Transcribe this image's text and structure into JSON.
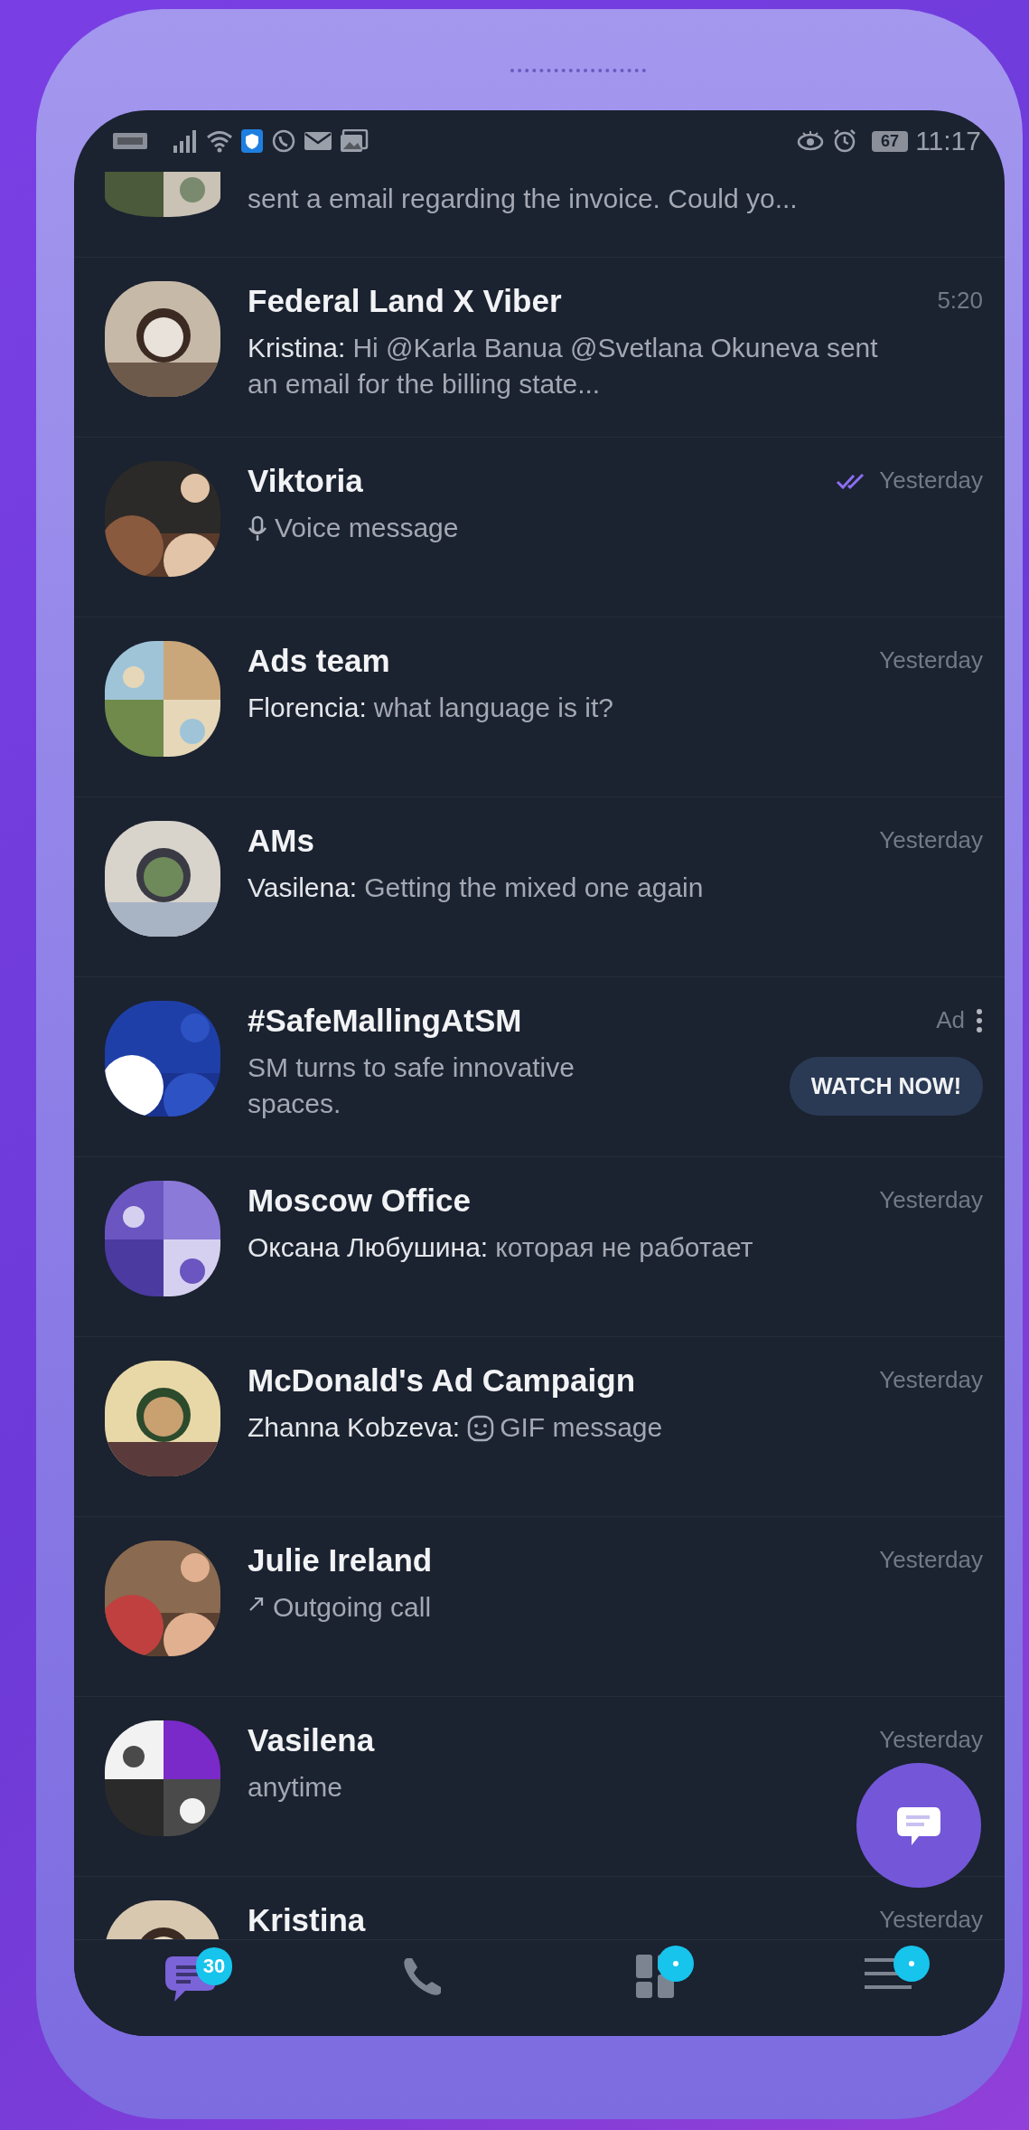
{
  "status_bar": {
    "battery": "67",
    "time": "11:17"
  },
  "partial_row": {
    "preview": "sent a email regarding the invoice. Could yo..."
  },
  "chats": [
    {
      "kind": "chat",
      "title": "Federal Land X Viber",
      "time": "5:20",
      "sender": "Kristina:",
      "preview": {
        "kind": "text",
        "text": "Hi @Karla Banua @Svetlana Okuneva sent an email for the billing state..."
      }
    },
    {
      "kind": "chat",
      "title": "Viktoria",
      "time": "Yesterday",
      "read": true,
      "preview": {
        "kind": "voice",
        "text": "Voice message"
      }
    },
    {
      "kind": "chat",
      "title": "Ads team",
      "time": "Yesterday",
      "sender": "Florencia:",
      "preview": {
        "kind": "text",
        "text": "what language is it?"
      }
    },
    {
      "kind": "chat",
      "title": "AMs",
      "time": "Yesterday",
      "sender": "Vasilena:",
      "preview": {
        "kind": "text",
        "text": "Getting the mixed one again"
      }
    },
    {
      "kind": "ad",
      "title": "#SafeMallingAtSM",
      "label": "Ad",
      "preview": "SM turns to safe innovative spaces.",
      "button": "WATCH NOW!"
    },
    {
      "kind": "chat",
      "title": "Moscow Office",
      "time": "Yesterday",
      "sender": "Оксана Любушина:",
      "preview": {
        "kind": "text",
        "text": "которая не работает"
      }
    },
    {
      "kind": "chat",
      "title": "McDonald's Ad Campaign",
      "time": "Yesterday",
      "sender": "Zhanna Kobzeva:",
      "preview": {
        "kind": "gif",
        "text": "GIF message"
      }
    },
    {
      "kind": "chat",
      "title": "Julie Ireland",
      "time": "Yesterday",
      "preview": {
        "kind": "call",
        "text": "Outgoing call"
      }
    },
    {
      "kind": "chat",
      "title": "Vasilena",
      "time": "Yesterday",
      "preview": {
        "kind": "text",
        "text": "anytime"
      }
    },
    {
      "kind": "chat",
      "title": "Kristina",
      "time": "Yesterday"
    }
  ],
  "nav": [
    {
      "kind": "chats",
      "selected": true,
      "badge": "30"
    },
    {
      "kind": "calls",
      "selected": false
    },
    {
      "kind": "explore",
      "selected": false,
      "new": true
    },
    {
      "kind": "more",
      "selected": false,
      "new": true
    }
  ]
}
